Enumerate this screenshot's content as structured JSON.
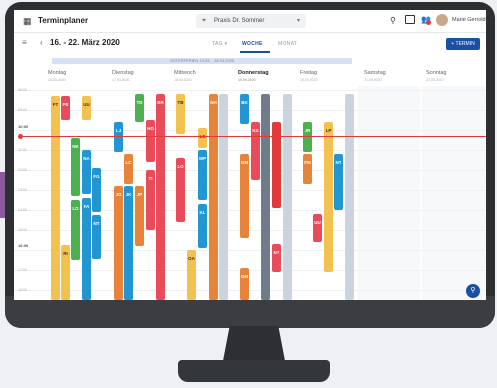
{
  "app": {
    "title": "Terminplaner"
  },
  "practice": {
    "label": "Praxis Dr. Sommer"
  },
  "user": {
    "name": "Marie Gerrold"
  },
  "toolbar": {
    "date_range": "16. - 22. März 2020",
    "tabs": [
      {
        "label": "TAG ▾",
        "active": false
      },
      {
        "label": "WOCHE",
        "active": true
      },
      {
        "label": "MONAT",
        "active": false
      }
    ],
    "new_button": "+ TERMIN"
  },
  "banner": "OSTERFERIEN 13.03. - 18.03.2020",
  "days": [
    {
      "name": "Montag",
      "date": "16.03.2020"
    },
    {
      "name": "Dienstag",
      "date": "17.03.2020"
    },
    {
      "name": "Mittwoch",
      "date": "18.03.2020"
    },
    {
      "name": "Donnerstag",
      "date": "19.03.2020"
    },
    {
      "name": "Freitag",
      "date": "20.03.2020"
    },
    {
      "name": "Samstag",
      "date": "21.03.2020"
    },
    {
      "name": "Sonntag",
      "date": "22.03.2020"
    }
  ],
  "times": [
    "08:00",
    "09:00",
    "10:00",
    "11:00",
    "12:00",
    "13:00",
    "14:00",
    "15:00",
    "16:00",
    "17:00",
    "18:00"
  ],
  "appointments": [
    {
      "label": "FT",
      "color": "#f2c14e"
    },
    {
      "label": "PE",
      "color": "#e94b5a"
    },
    {
      "label": "NK",
      "color": "#4caf50"
    },
    {
      "label": "LO",
      "color": "#4caf50"
    },
    {
      "label": "RI",
      "color": "#f2c14e"
    },
    {
      "label": "UU",
      "color": "#f2c14e"
    },
    {
      "label": "NA",
      "color": "#2196d3"
    },
    {
      "label": "FG",
      "color": "#2196d3"
    },
    {
      "label": "NT",
      "color": "#2196d3"
    },
    {
      "label": "FA",
      "color": "#2196d3"
    },
    {
      "label": "LJ",
      "color": "#2196d3"
    },
    {
      "label": "LC",
      "color": "#e8833a"
    },
    {
      "label": "JO",
      "color": "#e8833a"
    },
    {
      "label": "TD",
      "color": "#4caf50"
    },
    {
      "label": "JK",
      "color": "#2196d3"
    },
    {
      "label": "JP",
      "color": "#e8833a"
    },
    {
      "label": "HO",
      "color": "#e94b5a"
    },
    {
      "label": "BR",
      "color": "#e94b5a"
    },
    {
      "label": "TI",
      "color": "#e94b5a"
    },
    {
      "label": "LO",
      "color": "#e94b5a"
    },
    {
      "label": "TB",
      "color": "#f2c14e"
    },
    {
      "label": "WP",
      "color": "#2196d3"
    },
    {
      "label": "KL",
      "color": "#2196d3"
    },
    {
      "label": "OA",
      "color": "#f2c14e"
    },
    {
      "label": "LC",
      "color": "#f2c14e"
    },
    {
      "label": "NH",
      "color": "#e8833a"
    },
    {
      "label": "BK",
      "color": "#2196d3"
    },
    {
      "label": "GM",
      "color": "#e8833a"
    },
    {
      "label": "KS",
      "color": "#e94b5a"
    },
    {
      "label": "GM",
      "color": "#e8833a"
    },
    {
      "label": "NT",
      "color": "#e94b5a"
    },
    {
      "label": "JR",
      "color": "#4caf50"
    },
    {
      "label": "FM",
      "color": "#e8833a"
    },
    {
      "label": "LP",
      "color": "#f2c14e"
    },
    {
      "label": "UU",
      "color": "#e94b5a"
    },
    {
      "label": "NT",
      "color": "#2196d3"
    }
  ],
  "colors": {
    "accent": "#1a4fa3",
    "now_line": "#e23a3a"
  }
}
